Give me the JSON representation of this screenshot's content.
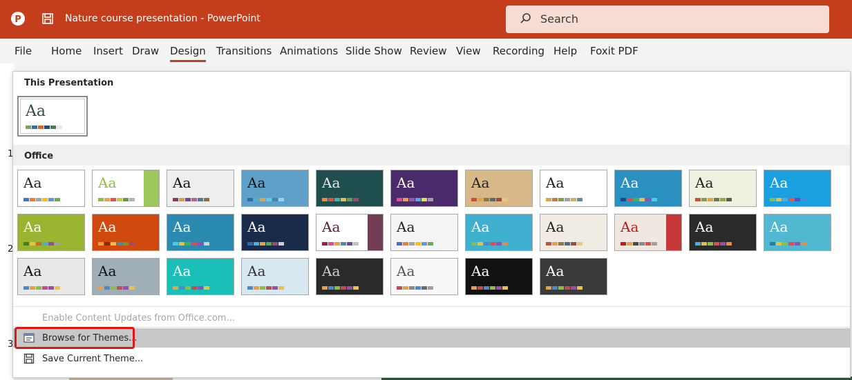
{
  "titlebar": {
    "title": "Nature course presentation  -  PowerPoint",
    "search_placeholder": "Search",
    "brand_color": "#c43e1c"
  },
  "ribbon": {
    "tabs": [
      "File",
      "Home",
      "Insert",
      "Draw",
      "Design",
      "Transitions",
      "Animations",
      "Slide Show",
      "Review",
      "View",
      "Recording",
      "Help",
      "Foxit PDF"
    ],
    "active_tab": "Design"
  },
  "slide_numbers": [
    "1",
    "2",
    "3"
  ],
  "gallery": {
    "section_this": "This Presentation",
    "section_office": "Office",
    "current_theme": {
      "aa": "Aa",
      "swatches": [
        "#8a9a6a",
        "#3a6a9a",
        "#d06a2a",
        "#2a4a7a",
        "#4a7a5a",
        "#e8e8e8"
      ]
    },
    "themes": [
      {
        "aa": "Aa",
        "bg": "#ffffff",
        "fg": "#222222",
        "swatches": [
          "#4472c4",
          "#ed7d31",
          "#a5a5a5",
          "#ffc000",
          "#5b9bd5",
          "#70ad47"
        ]
      },
      {
        "aa": "Aa",
        "bg": "#ffffff",
        "fg": "#8cbf3f",
        "accent": "#8cbf3f",
        "swatches": [
          "#8cbf3f",
          "#f2a33a",
          "#e8524a",
          "#c9c936",
          "#6a9b3a",
          "#b3b3b3"
        ]
      },
      {
        "aa": "Aa",
        "bg": "#eeeeee",
        "fg": "#111111",
        "swatches": [
          "#8a3a4a",
          "#d4a040",
          "#6a4a9a",
          "#c45a8a",
          "#4a7aa0",
          "#9a6a3a"
        ]
      },
      {
        "aa": "Aa",
        "bg": "#5fa0c8",
        "fg": "#111111",
        "swatches": [
          "#2d6e9e",
          "#4fb0d8",
          "#e8a040",
          "#6acbe0",
          "#3a8ab0",
          "#a0d0e8"
        ]
      },
      {
        "aa": "Aa",
        "bg": "#1f4e4e",
        "fg": "#e8e8e8",
        "swatches": [
          "#f08a3a",
          "#e84a4a",
          "#4ab0a0",
          "#e8c040",
          "#6a9a5a",
          "#a04a6a"
        ]
      },
      {
        "aa": "Aa",
        "bg": "#4a2a6a",
        "fg": "#ffffff",
        "swatches": [
          "#e84a8a",
          "#f0a040",
          "#8a5ab0",
          "#4ab0e0",
          "#e8e040",
          "#a0a0a0"
        ]
      },
      {
        "aa": "Aa",
        "bg": "#d8b888",
        "fg": "#222222",
        "swatches": [
          "#c8503a",
          "#e8a040",
          "#8a7a4a",
          "#4a6a8a",
          "#a04a3a",
          "#e8c880"
        ]
      },
      {
        "aa": "Aa",
        "bg": "#ffffff",
        "fg": "#222222",
        "swatches": [
          "#e8a040",
          "#c87a3a",
          "#8a9a4a",
          "#a0a0a0",
          "#d0b060",
          "#6a8a9a"
        ]
      },
      {
        "aa": "Aa",
        "bg": "#2a90c0",
        "fg": "#ffffff",
        "swatches": [
          "#1a4a8a",
          "#e84a4a",
          "#4ab04a",
          "#e8c040",
          "#a04ab0",
          "#4ad0e0"
        ]
      },
      {
        "aa": "Aa",
        "bg": "#eef0e0",
        "fg": "#222222",
        "swatches": [
          "#c8503a",
          "#8a9a4a",
          "#e8a040",
          "#6a7a4a",
          "#a0a040",
          "#4a6a3a"
        ]
      },
      {
        "aa": "Aa",
        "bg": "#1aa0e0",
        "fg": "#ffffff",
        "swatches": [
          "#8cbf3f",
          "#e8c040",
          "#4ab0e0",
          "#e8524a",
          "#6a4ab0",
          "#4a8ad0"
        ]
      },
      {
        "aa": "Aa",
        "bg": "#98b430",
        "fg": "#ffffff",
        "swatches": [
          "#4a7a2a",
          "#e8c040",
          "#d06a2a",
          "#4ab0d0",
          "#8a4ab0",
          "#a0a0a0"
        ]
      },
      {
        "aa": "Aa",
        "bg": "#d04a10",
        "fg": "#ffffff",
        "swatches": [
          "#e8a040",
          "#8a2a0a",
          "#f0c040",
          "#4a8ab0",
          "#6a9a3a",
          "#a04a6a"
        ]
      },
      {
        "aa": "Aa",
        "bg": "#2a8ab0",
        "fg": "#ffffff",
        "swatches": [
          "#4ad0e0",
          "#e8c040",
          "#4ab04a",
          "#e84a4a",
          "#a04ab0",
          "#d0d0d0"
        ]
      },
      {
        "aa": "Aa",
        "bg": "#1a2a4a",
        "fg": "#ffffff",
        "swatches": [
          "#2a6ab0",
          "#4ab0e0",
          "#e8a040",
          "#4ab04a",
          "#a04a6a",
          "#d0d0d0"
        ]
      },
      {
        "aa": "Aa",
        "bg": "#ffffff",
        "fg": "#5a1a3a",
        "accent": "#5a1a3a",
        "swatches": [
          "#a01a4a",
          "#e84a8a",
          "#e8a040",
          "#4a8ab0",
          "#6a4a9a",
          "#c0c0c0"
        ]
      },
      {
        "aa": "Aa",
        "bg": "#f4f4f4",
        "fg": "#222222",
        "swatches": [
          "#4472c4",
          "#ed7d31",
          "#a5a5a5",
          "#ffc000",
          "#5b9bd5",
          "#70ad47"
        ]
      },
      {
        "aa": "Aa",
        "bg": "#40b0d0",
        "fg": "#ffffff",
        "swatches": [
          "#8cbf3f",
          "#e8c040",
          "#4a8ad0",
          "#e84a4a",
          "#a04ab0",
          "#f08a3a"
        ]
      },
      {
        "aa": "Aa",
        "bg": "#f0ece4",
        "fg": "#222222",
        "swatches": [
          "#c8503a",
          "#e8a040",
          "#8a7a4a",
          "#4a6a8a",
          "#a04a3a",
          "#e8c880"
        ]
      },
      {
        "aa": "Aa",
        "bg": "#f0e8e0",
        "fg": "#c01a1a",
        "accent": "#c01a1a",
        "swatches": [
          "#c01a1a",
          "#e8a040",
          "#4a4a4a",
          "#8a8a8a",
          "#e84a4a",
          "#a0a0a0"
        ]
      },
      {
        "aa": "Aa",
        "bg": "#2a2a2a",
        "fg": "#ffffff",
        "swatches": [
          "#4ab0e0",
          "#e8c040",
          "#8cbf3f",
          "#e84a4a",
          "#a04ab0",
          "#f08a3a"
        ]
      },
      {
        "aa": "Aa",
        "bg": "#50b8d0",
        "fg": "#ffffff",
        "swatches": [
          "#2a7a9a",
          "#e8c040",
          "#8cbf3f",
          "#e84a4a",
          "#a04ab0",
          "#f08a3a"
        ]
      },
      {
        "aa": "Aa",
        "bg": "#e8e8e8",
        "fg": "#111111",
        "swatches": [
          "#4a8ad0",
          "#e8a040",
          "#8cbf3f",
          "#c84a8a",
          "#a04ab0",
          "#f0c040"
        ]
      },
      {
        "aa": "Aa",
        "bg": "#a0aeb8",
        "fg": "#111111",
        "swatches": [
          "#e8a040",
          "#4a8ad0",
          "#8cbf3f",
          "#c84a4a",
          "#a04ab0",
          "#f0c040"
        ]
      },
      {
        "aa": "Aa",
        "bg": "#1ac0b8",
        "fg": "#ffffff",
        "swatches": [
          "#e8a040",
          "#4a8ad0",
          "#8cbf3f",
          "#c84a4a",
          "#a04ab0",
          "#f0c040"
        ]
      },
      {
        "aa": "Aa",
        "bg": "#d8e8f0",
        "fg": "#333333",
        "swatches": [
          "#4a8ad0",
          "#e8a040",
          "#8cbf3f",
          "#c84a4a",
          "#a04ab0",
          "#f0c040"
        ]
      },
      {
        "aa": "Aa",
        "bg": "#2a2a2a",
        "fg": "#d0d0d0",
        "swatches": [
          "#e8a040",
          "#4a8ad0",
          "#8cbf3f",
          "#c84a4a",
          "#a04ab0",
          "#f0c040"
        ]
      },
      {
        "aa": "Aa",
        "bg": "#f8f8f8",
        "fg": "#555555",
        "swatches": [
          "#c84a4a",
          "#e8a040",
          "#8a8a8a",
          "#4a8ad0",
          "#6a6a6a",
          "#a0a0a0"
        ]
      },
      {
        "aa": "Aa",
        "bg": "#111111",
        "fg": "#ffffff",
        "swatches": [
          "#e8a040",
          "#c84a4a",
          "#4a8ad0",
          "#8cbf3f",
          "#a04ab0",
          "#f0c040"
        ]
      },
      {
        "aa": "Aa",
        "bg": "#3a3a3a",
        "fg": "#ffffff",
        "swatches": [
          "#e8a040",
          "#4a8ad0",
          "#8cbf3f",
          "#c84a4a",
          "#a04ab0",
          "#f0c040"
        ]
      }
    ]
  },
  "menu": {
    "enable_updates": "Enable Content Updates from Office.com...",
    "browse_themes": "Browse for Themes...",
    "save_theme": "Save Current Theme..."
  }
}
